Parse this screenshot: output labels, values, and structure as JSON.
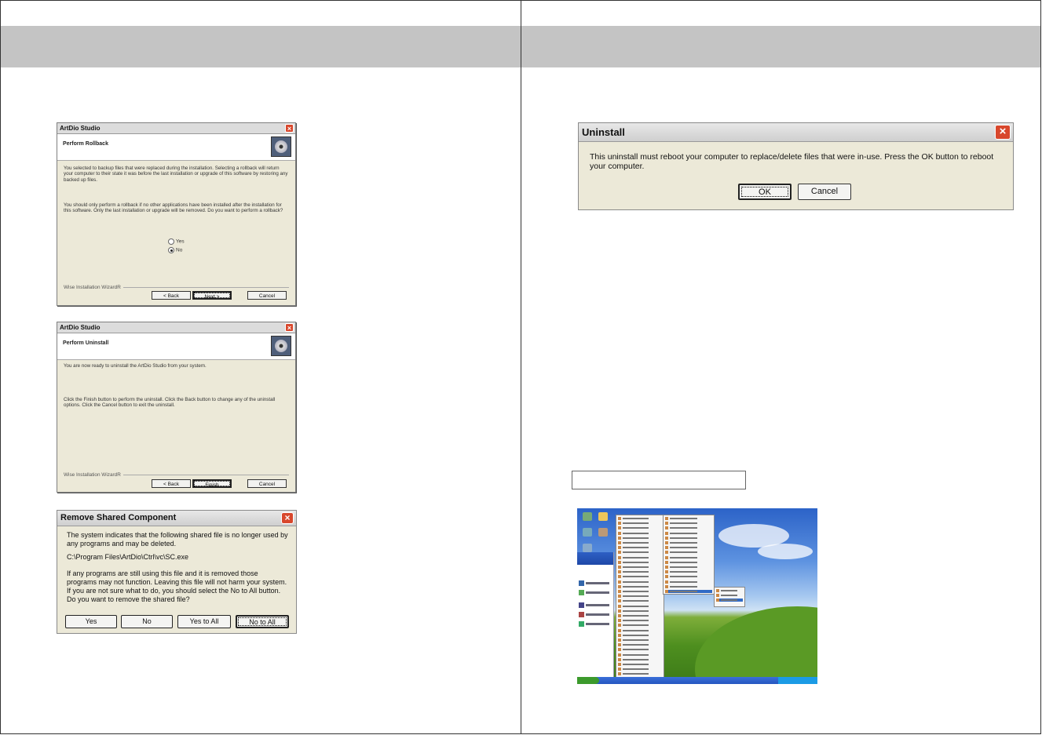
{
  "dialog_rollback": {
    "title": "ArtDio Studio",
    "heading": "Perform Rollback",
    "para1": "You selected to backup files that were replaced during the installation. Selecting a rollback will return your computer to their state it was before the last installation or upgrade of this software by restoring any backed up files.",
    "para2": "You should only perform a rollback if no other applications have been installed after the installation for this software. Only the last installation or upgrade will be removed. Do you want to perform a rollback?",
    "option_yes": "Yes",
    "option_no": "No",
    "selected": "No",
    "brand": "Wise Installation WizardR",
    "back_label": "< Back",
    "next_label": "Next >",
    "cancel_label": "Cancel"
  },
  "dialog_uninstall_wizard": {
    "title": "ArtDio Studio",
    "heading": "Perform Uninstall",
    "para1": "You are now ready to uninstall the ArtDio Studio from your system.",
    "para2": "Click the Finish button to perform the uninstall. Click the Back button to change any of the uninstall options. Click the Cancel button to exit the uninstall.",
    "brand": "Wise Installation WizardR",
    "back_label": "< Back",
    "finish_label": "Finish",
    "cancel_label": "Cancel"
  },
  "dialog_shared": {
    "title": "Remove Shared Component",
    "line1": "The system indicates that the following shared file is no longer used by any programs and may be deleted.",
    "path": "C:\\Program Files\\ArtDio\\Ctrl\\vc\\SC.exe",
    "line2": "If any programs are still using this file and it is removed those programs may not function. Leaving this file will not harm your system. If you are not sure what to do, you should select the No to All button. Do you want to remove the shared file?",
    "yes_label": "Yes",
    "no_label": "No",
    "yes_all_label": "Yes to All",
    "no_all_label": "No to All"
  },
  "dialog_reboot": {
    "title": "Uninstall",
    "message": "This uninstall must reboot your computer to replace/delete files that were in-use. Press the OK button to reboot your computer.",
    "ok_label": "OK",
    "cancel_label": "Cancel"
  },
  "desktop": {
    "start_label": "start",
    "all_programs": "All Programs"
  }
}
